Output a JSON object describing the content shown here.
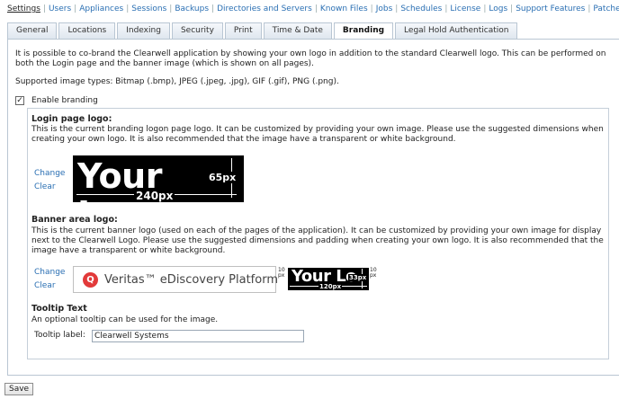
{
  "nav": {
    "items": [
      "Settings",
      "Users",
      "Appliances",
      "Sessions",
      "Backups",
      "Directories and Servers",
      "Known Files",
      "Jobs",
      "Schedules",
      "License",
      "Logs",
      "Support Features",
      "Patches"
    ]
  },
  "tabs": [
    "General",
    "Locations",
    "Indexing",
    "Security",
    "Print",
    "Time & Date",
    "Branding",
    "Legal Hold Authentication"
  ],
  "intro": "It is possible to co-brand the Clearwell application by showing your own logo in addition to the standard Clearwell logo. This can be performed on both the Login page and the banner image (which is shown on all pages).",
  "supported": "Supported image types: Bitmap (.bmp), JPEG (.jpeg, .jpg), GIF (.gif), PNG (.png).",
  "enable_label": "Enable branding",
  "enable_check": "✓",
  "login": {
    "heading": "Login page logo:",
    "desc": "This is the current branding logon page logo. It can be customized by providing your own image. Please use the suggested dimensions when creating your own logo. It is also recommended that the image have a transparent or white background.",
    "change": "Change",
    "clear": "Clear",
    "logo_text": "Your Logo",
    "width_label": "240px",
    "height_label": "65px"
  },
  "banner": {
    "heading": "Banner area logo:",
    "desc": "This is the current banner logo (used on each of the pages of the application). It can be customized by providing your own image for display next to the Clearwell Logo. Please use the suggested dimensions and padding when creating your own logo. It is also recommended that the image have a transparent or white background.",
    "change": "Change",
    "clear": "Clear",
    "veritas_text": "Veritas™ eDiscovery Platform",
    "logo_text": "Your Lo",
    "width_label": "120px",
    "height_label": "33px",
    "pad_left": "10 px",
    "pad_right": "10 px"
  },
  "tooltip": {
    "heading": "Tooltip Text",
    "desc": "An optional tooltip can be used for the image.",
    "label": "Tooltip label:",
    "value": "Clearwell Systems"
  },
  "save_label": "Save"
}
